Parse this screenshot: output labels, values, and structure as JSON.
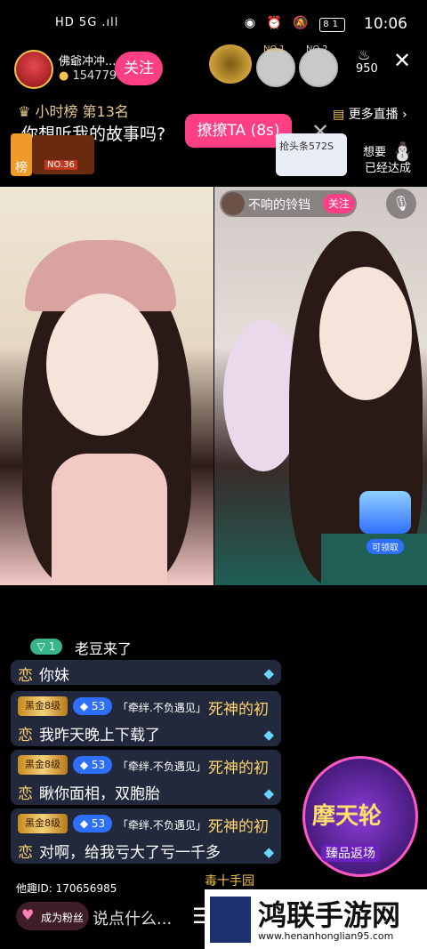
{
  "status": {
    "carrier": "HD 5G .ıll",
    "time": "10:06",
    "battery": "81"
  },
  "header": {
    "streamer_name": "佛爺冲冲...",
    "likes": "154779",
    "follow_label": "关注",
    "viewer_count": "950",
    "rank_no1": "NO.1",
    "rank_no2": "NO.2"
  },
  "subheader": {
    "rank_text": "小时榜 第13名",
    "more_live": "更多直播"
  },
  "prompt": {
    "question": "你想听我的故事吗?",
    "tease_button": "撩撩TA (8s)"
  },
  "badges": {
    "hour_rank_char": "榜",
    "rank_no": "NO.36",
    "grab_head": "抢头条572S",
    "want_text": "想要",
    "achieved_text": "已经达成"
  },
  "guest": {
    "name": "不响的铃铛",
    "follow_label": "关注",
    "claim_label": "可领取"
  },
  "chat": {
    "arrival_level": "1",
    "arrival_name": "老豆来了",
    "messages": [
      {
        "prefix": "恋",
        "text": "你妹",
        "partial": true
      },
      {
        "level_badge": "黑金8级",
        "gem_level": "53",
        "tag": "「牵绊.不负遇见」",
        "name": "死神的初",
        "prefix": "恋",
        "text": "我昨天晚上下载了"
      },
      {
        "level_badge": "黑金8级",
        "gem_level": "53",
        "tag": "「牵绊.不负遇见」",
        "name": "死神的初",
        "prefix": "恋",
        "text": "瞅你面相，双胞胎"
      },
      {
        "level_badge": "黑金8级",
        "gem_level": "53",
        "tag": "「牵绊.不负遇见」",
        "name": "死神的初",
        "prefix": "恋",
        "text": "对啊，给我亏大了亏一千多"
      }
    ],
    "cutoff_name": "毒十手园"
  },
  "promo": {
    "title": "摩天轮",
    "subtitle": "臻品返场"
  },
  "footer": {
    "room_id": "他趣ID:  170656985",
    "fan_label": "成为粉丝",
    "input_placeholder": "说点什么...",
    "watermark_title": "鸿联手游网",
    "watermark_url": "www.henanhonglian95.com"
  },
  "colors": {
    "accent_pink": "#ff3f84",
    "gold": "#f2c14e",
    "chat_bg": "#283046"
  }
}
